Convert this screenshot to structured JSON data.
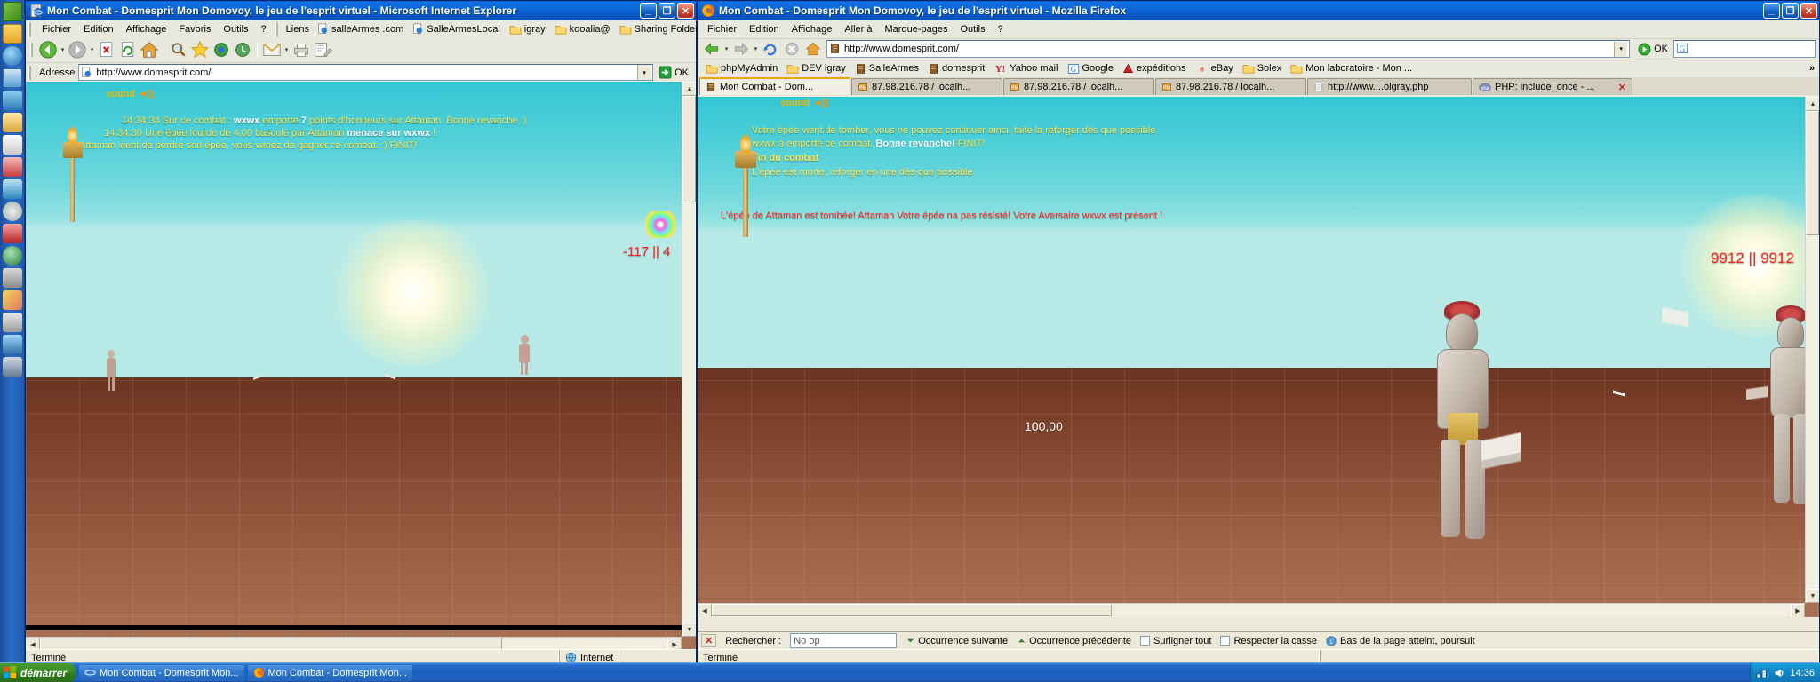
{
  "desktop": {
    "quick_launch": [
      "start-orb",
      "folder-icon",
      "ie-icon",
      "media-icon",
      "msn-icon",
      "outlook-icon",
      "notes-icon",
      "chat-icon",
      "photo-icon",
      "disc-icon",
      "shield-icon",
      "globe-icon",
      "tools-icon",
      "paint-icon",
      "calc-icon",
      "net-icon",
      "settings-icon"
    ]
  },
  "taskbar": {
    "start_label": "démarrer",
    "tasks": [
      {
        "label": "Mon Combat - Domesprit Mon...",
        "icon": "ie-icon"
      },
      {
        "label": "Mon Combat - Domesprit Mon...",
        "icon": "firefox-icon"
      }
    ],
    "tray_time": "14:36",
    "tray_icons": [
      "network-icon",
      "volume-icon"
    ]
  },
  "ie": {
    "title": "Mon Combat - Domesprit Mon Domovoy, le jeu de l'esprit virtuel - Microsoft Internet Explorer",
    "icon": "ie-document-icon",
    "window_buttons": [
      "minimize",
      "maximize",
      "close"
    ],
    "menus": [
      "Fichier",
      "Edition",
      "Affichage",
      "Favoris",
      "Outils",
      "?"
    ],
    "links_label": "Liens",
    "links": [
      {
        "label": "salleArmes .com",
        "icon": "ie-page-icon"
      },
      {
        "label": "SalleArmesLocal",
        "icon": "ie-page-icon"
      },
      {
        "label": "igray",
        "icon": "folder-icon"
      },
      {
        "label": "kooalia@",
        "icon": "folder-icon"
      },
      {
        "label": "Sharing Folders",
        "icon": "folder-icon"
      }
    ],
    "toolbar_buttons": [
      "back-icon",
      "forward-icon",
      "stop-icon",
      "refresh-icon",
      "home-icon",
      "search-icon",
      "favorites-icon",
      "media-icon",
      "history-icon",
      "mail-icon",
      "print-icon",
      "edit-icon"
    ],
    "address_label": "Adresse",
    "address_value": "http://www.domesprit.com/",
    "go_label": "OK",
    "status_left": "Terminé",
    "status_zone": "Internet"
  },
  "firefox": {
    "title": "Mon Combat - Domesprit Mon Domovoy, le jeu de l'esprit virtuel - Mozilla Firefox",
    "icon": "firefox-icon",
    "window_buttons": [
      "minimize",
      "restore",
      "close"
    ],
    "menus": [
      "Fichier",
      "Edition",
      "Affichage",
      "Aller à",
      "Marque-pages",
      "Outils",
      "?"
    ],
    "toolbar_buttons": [
      "back-icon",
      "forward-icon",
      "reload-icon",
      "stop-icon",
      "home-icon"
    ],
    "address_value": "http://www.domesprit.com/",
    "go_label": "OK",
    "search_placeholder": "",
    "search_engine_icon": "google-icon",
    "bookmarks": [
      {
        "label": "phpMyAdmin",
        "icon": "folder-icon"
      },
      {
        "label": "DEV igray",
        "icon": "folder-icon"
      },
      {
        "label": "SalleArmes",
        "icon": "domesprit-icon"
      },
      {
        "label": "domesprit",
        "icon": "domesprit-icon"
      },
      {
        "label": "Yahoo mail",
        "icon": "yahoo-icon"
      },
      {
        "label": "Google",
        "icon": "google-icon"
      },
      {
        "label": "expéditions",
        "icon": "red-icon"
      },
      {
        "label": "eBay",
        "icon": "ebay-icon"
      },
      {
        "label": "Solex",
        "icon": "folder-icon"
      },
      {
        "label": "Mon laboratoire - Mon ...",
        "icon": "folder-icon"
      }
    ],
    "bookmarks_overflow": "»",
    "tabs": [
      {
        "label": "Mon Combat - Dom...",
        "icon": "domesprit-icon",
        "active": true
      },
      {
        "label": "87.98.216.78 / localh...",
        "icon": "phpmyadmin-icon",
        "active": false
      },
      {
        "label": "87.98.216.78 / localh...",
        "icon": "phpmyadmin-icon",
        "active": false
      },
      {
        "label": "87.98.216.78 / localh...",
        "icon": "phpmyadmin-icon",
        "active": false
      },
      {
        "label": "http://www....olgray.php",
        "icon": "page-icon",
        "active": false
      },
      {
        "label": "PHP: include_once -  ...",
        "icon": "php-icon",
        "active": false
      }
    ],
    "tab_close_label": "✕",
    "status_left": "Terminé",
    "findbar": {
      "close_label": "✕",
      "label": "Rechercher :",
      "value": "No op",
      "next_label": "Occurrence suivante",
      "prev_label": "Occurrence précédente",
      "highlight_label": "Surligner tout",
      "matchcase_label": "Respecter la casse",
      "reached_label": "Bas de la page atteint, poursuit"
    }
  },
  "game_left": {
    "sound_label": "sound",
    "sound_icon": "speaker-icon",
    "log": [
      {
        "time": "14:34:34",
        "text_before": "Sur ce combat : ",
        "hl1": "wxwx",
        "text_mid": " emporte ",
        "hl2": "7",
        "text_after": " points d'honneurs sur Attaman. Bonne revanche :)"
      },
      {
        "time": "14:34:30",
        "text_before": "Une épée lourde de 4.00  basculé par Attaman ",
        "hl1": "menace sur",
        "text_mid": " ",
        "hl2": "wxwx",
        "text_after": " !"
      },
      {
        "time": "",
        "text_before": "Attaman vient de perdre son épée, vous venez de gagner ce combat. :) FINIT!",
        "hl1": "",
        "text_mid": "",
        "hl2": "",
        "text_after": ""
      }
    ],
    "score": "-117 || 4"
  },
  "game_right": {
    "sound_label": "sound",
    "sound_icon": "speaker-icon",
    "log": [
      {
        "text": "Votre épée vient de tomber, vous ne pouvez continuer ainci, faite la reforger dès que possible."
      },
      {
        "text": "wxwx à emporté ce combat. ",
        "bold": "Bonne revanche!",
        "after": " FINIT!"
      },
      {
        "bold_line": "Fin du combat"
      },
      {
        "text": "L'épée est morte, reforger en une dès que possible."
      }
    ],
    "alert": "L'épée de Attaman est tombée! Attaman Votre épée na pas résisté!  Votre Aversaire wxwx est présent !",
    "score": "9912 || 9912",
    "damage": "100,00"
  },
  "colors": {
    "log_yellow": "#ffe34d",
    "log_white": "#ffffff",
    "alert_red": "#ff2a2a",
    "score_red": "#ff1e1e",
    "sound_gold": "#f2b705",
    "chrome_bg": "#ece9d8",
    "title_blue": "#0a5fcf"
  }
}
